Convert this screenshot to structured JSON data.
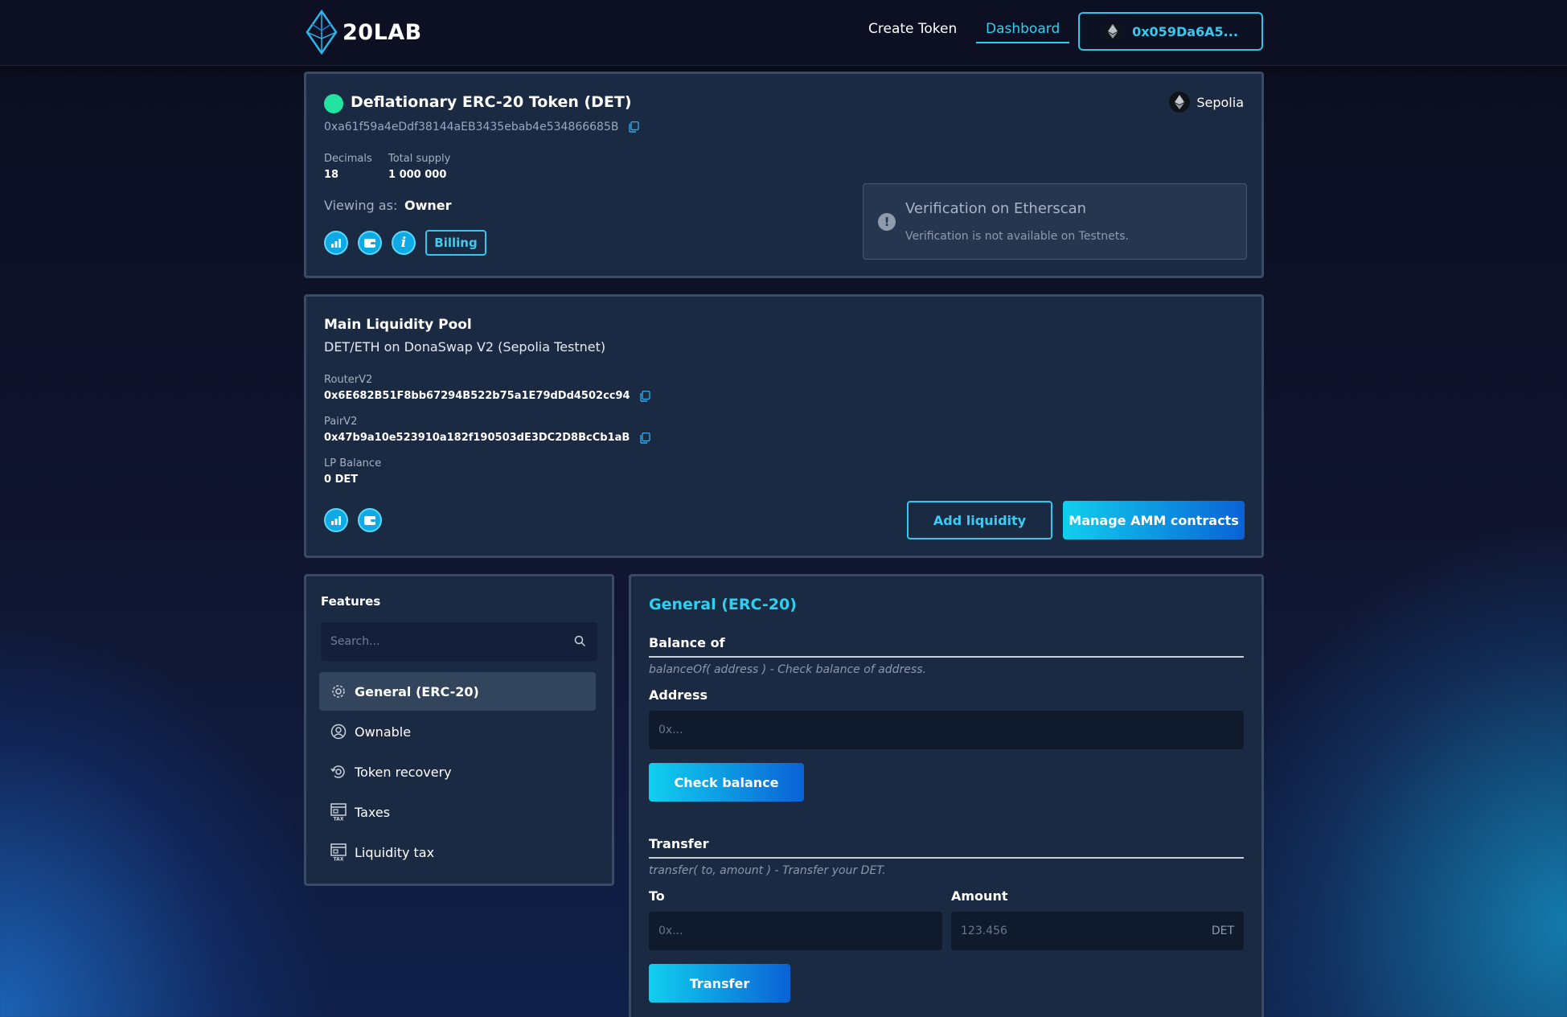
{
  "nav": {
    "logo": "20LAB",
    "create_token": "Create Token",
    "dashboard": "Dashboard",
    "wallet": "0x059Da6A5..."
  },
  "token": {
    "name": "Deflationary ERC-20 Token (DET)",
    "address": "0xa61f59a4eDdf38144aEB3435ebab4e534866685B",
    "network": "Sepolia",
    "decimals_label": "Decimals",
    "decimals": "18",
    "supply_label": "Total supply",
    "supply": "1 000 000",
    "viewing_label": "Viewing as:",
    "viewing_value": "Owner",
    "billing": "Billing",
    "verification_title": "Verification on Etherscan",
    "verification_text": "Verification is not available on Testnets.",
    "status_color": "#22e3a0"
  },
  "pool": {
    "title": "Main Liquidity Pool",
    "subtitle": "DET/ETH on DonaSwap V2 (Sepolia Testnet)",
    "router_label": "RouterV2",
    "router": "0x6E682B51F8bb67294B522b75a1E79dDd4502cc94",
    "pair_label": "PairV2",
    "pair": "0x47b9a10e523910a182f190503dE3DC2D8BcCb1aB",
    "lp_label": "LP Balance",
    "lp_value": "0 DET",
    "add_liquidity": "Add liquidity",
    "manage_amm": "Manage AMM contracts"
  },
  "features": {
    "title": "Features",
    "search_placeholder": "Search...",
    "items": [
      {
        "label": "General (ERC-20)",
        "icon": "gear-cog-icon"
      },
      {
        "label": "Ownable",
        "icon": "user-circle-icon"
      },
      {
        "label": "Token recovery",
        "icon": "recovery-icon"
      },
      {
        "label": "Taxes",
        "icon": "tax-icon"
      },
      {
        "label": "Liquidity tax",
        "icon": "tax-icon"
      }
    ]
  },
  "general": {
    "title": "General (ERC-20)",
    "balance_title": "Balance of",
    "balance_desc": "balanceOf( address ) - Check balance of address.",
    "address_label": "Address",
    "address_placeholder": "0x...",
    "check_balance": "Check balance",
    "transfer_title": "Transfer",
    "transfer_desc": "transfer( to, amount ) - Transfer your DET.",
    "to_label": "To",
    "to_placeholder": "0x...",
    "amount_label": "Amount",
    "amount_placeholder": "123.456",
    "amount_unit": "DET",
    "transfer_button": "Transfer"
  },
  "colors": {
    "accent": "#2fd0ef",
    "card_bg": "#1b2a43",
    "card_border": "#3a4b66"
  }
}
